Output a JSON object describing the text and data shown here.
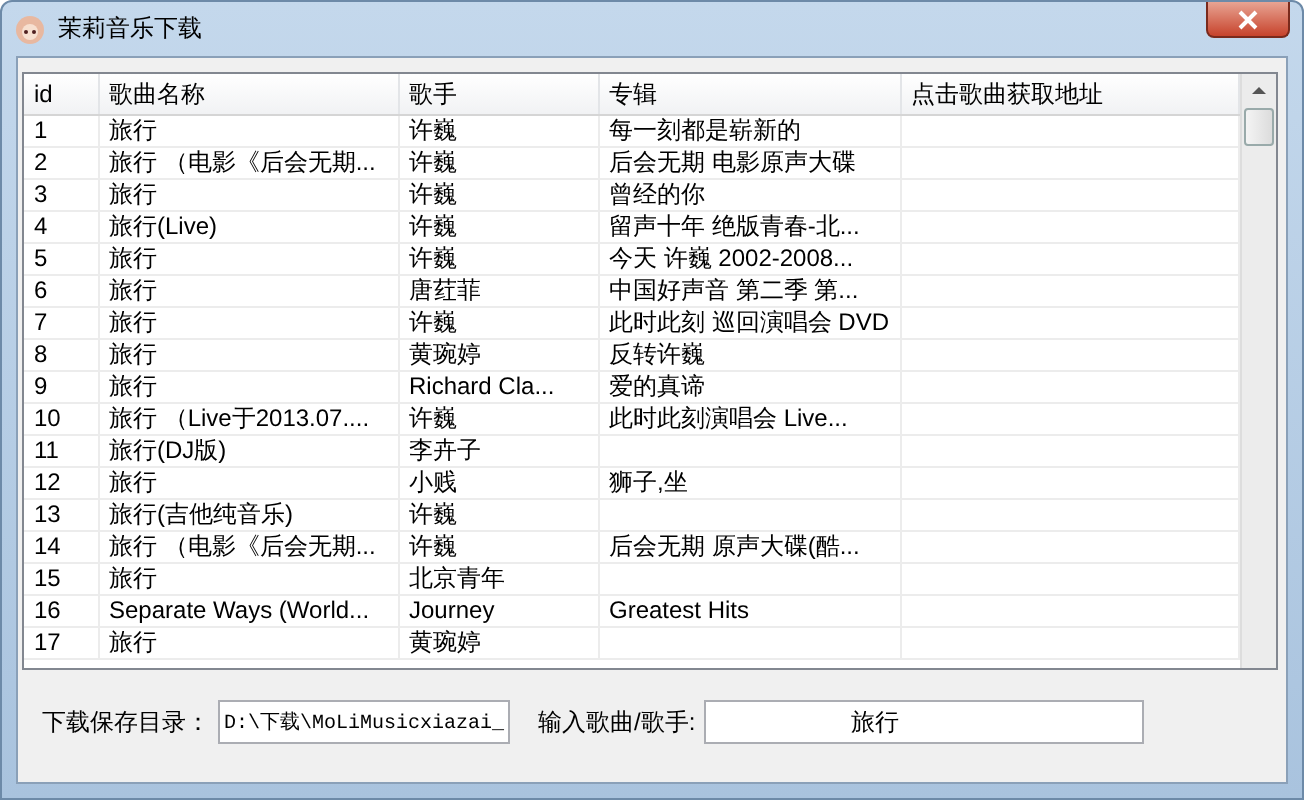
{
  "window": {
    "title": "茉莉音乐下载"
  },
  "table": {
    "columns": [
      "id",
      "歌曲名称",
      "歌手",
      "专辑",
      "点击歌曲获取地址"
    ],
    "rows": [
      {
        "id": "1",
        "title": "旅行",
        "artist": "许巍",
        "album": "每一刻都是崭新的"
      },
      {
        "id": "2",
        "title": "旅行 （电影《后会无期...",
        "artist": "许巍",
        "album": "后会无期 电影原声大碟"
      },
      {
        "id": "3",
        "title": "旅行",
        "artist": "许巍",
        "album": "曾经的你"
      },
      {
        "id": "4",
        "title": "旅行(Live)",
        "artist": "许巍",
        "album": "留声十年 绝版青春-北..."
      },
      {
        "id": "5",
        "title": "旅行",
        "artist": "许巍",
        "album": "今天 许巍 2002-2008..."
      },
      {
        "id": "6",
        "title": "旅行",
        "artist": "唐荭菲",
        "album": "中国好声音 第二季 第..."
      },
      {
        "id": "7",
        "title": "旅行",
        "artist": "许巍",
        "album": "此时此刻 巡回演唱会 DVD"
      },
      {
        "id": "8",
        "title": "旅行",
        "artist": "黄琬婷",
        "album": "反转许巍"
      },
      {
        "id": "9",
        "title": "旅行",
        "artist": "Richard Cla...",
        "album": "爱的真谛"
      },
      {
        "id": "10",
        "title": "旅行 （Live于2013.07....",
        "artist": "许巍",
        "album": "此时此刻演唱会 Live..."
      },
      {
        "id": "11",
        "title": "旅行(DJ版)",
        "artist": "李卉子"
      },
      {
        "id": "12",
        "title": "旅行",
        "artist": "小贱",
        "album": "狮子,坐"
      },
      {
        "id": "13",
        "title": "旅行(吉他纯音乐)",
        "artist": "许巍"
      },
      {
        "id": "14",
        "title": "旅行 （电影《后会无期...",
        "artist": "许巍",
        "album": "后会无期 原声大碟(酷..."
      },
      {
        "id": "15",
        "title": "旅行",
        "artist": "北京青年"
      },
      {
        "id": "16",
        "title": "Separate Ways (World...",
        "artist": "Journey",
        "album": "Greatest Hits"
      },
      {
        "id": "17",
        "title": "旅行",
        "artist": "黄琬婷"
      }
    ]
  },
  "footer": {
    "save_dir_label": "下载保存目录：",
    "save_dir": "D:\\下载\\MoLiMusicxiazai_",
    "search_label": "输入歌曲/歌手:",
    "search": "旅行"
  }
}
